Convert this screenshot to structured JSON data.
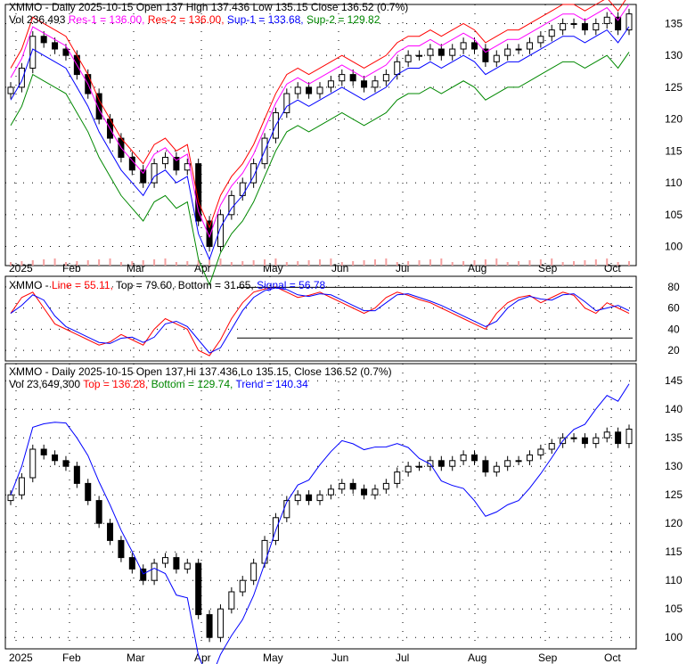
{
  "chart_data": {
    "type": "candlestick",
    "symbol": "XMMO",
    "panel1": {
      "title": "XMMO - Daily 2025-10-15 Open 137  High 137.436  Low 135.15  Close 136.52 (0.7%)",
      "vol": "Vol 236,493",
      "res1": "Res-1 = 136.00,",
      "res2": "Res-2 = 136.00,",
      "sup1": "Sup-1 = 133.68,",
      "sup2": "Sup-2 = 129.82",
      "ylim": [
        97,
        138
      ],
      "yticks": [
        100,
        105,
        110,
        115,
        120,
        125,
        130,
        135
      ]
    },
    "panel2": {
      "title": "XMMO - ",
      "line": "Line = 55.11,",
      "top": "Top = 79.60,",
      "bottom": "Bottom = 31.65,",
      "signal": "Signal = 56.78",
      "ylim": [
        10,
        90
      ],
      "yticks": [
        20,
        40,
        60,
        80
      ]
    },
    "panel3": {
      "title": "XMMO - Daily 2025-10-15 Open 137,Hi 137.436,Lo 135.15, Close 136.52 (0.7%)",
      "vol": "Vol 23,649,300",
      "top": "Top = 136.28,",
      "bottom": "Bottom = 129.74,",
      "trend": "Trend = 140.34",
      "ylim": [
        98,
        148
      ],
      "yticks": [
        100,
        105,
        110,
        115,
        120,
        125,
        130,
        135,
        140,
        145
      ]
    },
    "xticks": [
      "2025",
      "Feb",
      "Mar",
      "Apr",
      "May",
      "Jun",
      "Jul",
      "Aug",
      "Sep",
      "Oct"
    ],
    "closes": [
      125,
      128,
      133,
      132,
      131,
      130,
      127,
      124,
      120,
      117,
      114,
      112,
      110,
      113,
      114,
      112,
      113,
      104,
      100,
      105,
      108,
      110,
      113,
      117,
      121,
      124,
      125,
      124,
      125,
      126,
      127,
      126,
      125,
      126,
      127,
      129,
      130,
      130,
      131,
      130,
      131,
      132,
      131,
      129,
      130,
      131,
      131,
      132,
      133,
      134,
      135,
      135,
      134,
      135,
      136,
      134,
      136.52
    ],
    "oscillator": [
      55,
      70,
      75,
      60,
      45,
      40,
      35,
      30,
      25,
      28,
      35,
      30,
      25,
      40,
      50,
      45,
      40,
      20,
      15,
      30,
      50,
      65,
      75,
      78,
      80,
      75,
      70,
      72,
      75,
      70,
      65,
      60,
      55,
      60,
      70,
      75,
      72,
      68,
      65,
      60,
      55,
      50,
      45,
      40,
      55,
      65,
      70,
      72,
      65,
      70,
      75,
      72,
      60,
      55,
      65,
      60,
      55
    ],
    "colors": {
      "up": "#ffffff",
      "down": "#000000",
      "res1": "#ff00ff",
      "res2": "#ff0000",
      "sup1": "#0000ff",
      "sup2": "#008800",
      "volume": "#f4a0a0"
    }
  }
}
